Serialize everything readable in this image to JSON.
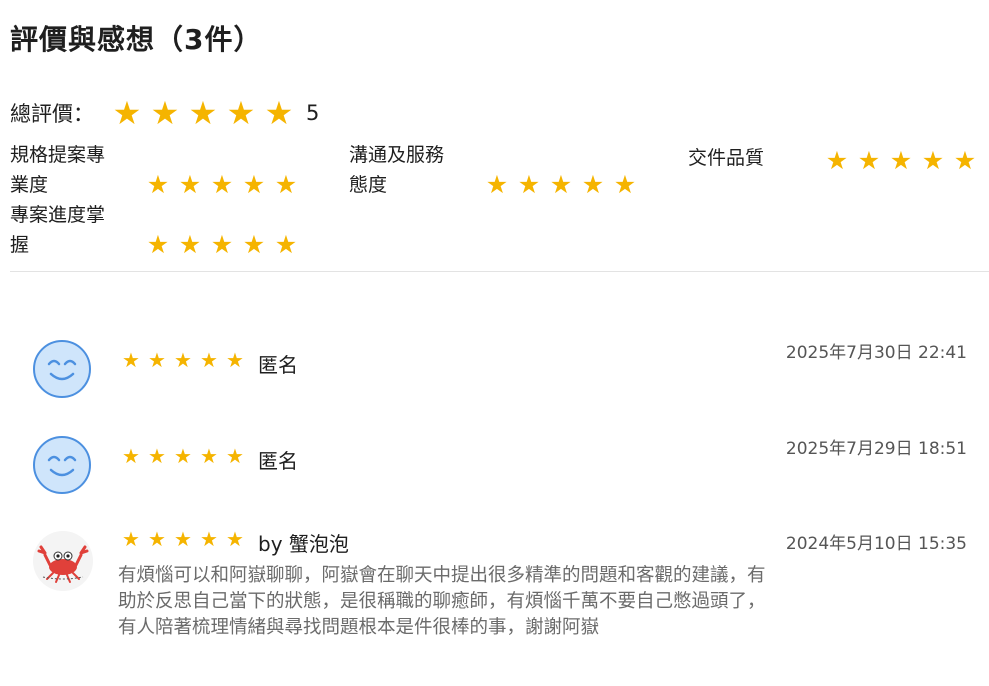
{
  "page_title": "評價與感想（3件）",
  "overall": {
    "label": "總評價：",
    "rating": 5,
    "score_text": "5"
  },
  "criteria": [
    {
      "label_line1": "規格提案專",
      "label_line2": "業度",
      "rating": 5
    },
    {
      "label_line1": "溝通及服務",
      "label_line2": "態度",
      "rating": 5
    },
    {
      "label_line1": "交件品質",
      "label_line2": "",
      "rating": 5
    },
    {
      "label_line1": "專案進度掌",
      "label_line2": "握",
      "rating": 5
    }
  ],
  "reviews": [
    {
      "rating": 5,
      "name": "匿名",
      "date": "2025年7月30日 22:41",
      "comment": "",
      "avatar": "smiley-icon"
    },
    {
      "rating": 5,
      "name": "匿名",
      "date": "2025年7月29日 18:51",
      "comment": "",
      "avatar": "smiley-icon"
    },
    {
      "rating": 5,
      "name": "by 蟹泡泡",
      "date": "2024年5月10日 15:35",
      "comment": "有煩惱可以和阿嶽聊聊，阿嶽會在聊天中提出很多精準的問題和客觀的建議，有助於反思自己當下的狀態，是很稱職的聊癒師，有煩惱千萬不要自己憋過頭了，有人陪著梳理情緒與尋找問題根本是件很棒的事，謝謝阿嶽",
      "avatar": "crab-icon"
    }
  ],
  "colors": {
    "star": "#f5b400",
    "avatar_fill": "#cfe5fb",
    "avatar_border": "#4c90e0"
  }
}
